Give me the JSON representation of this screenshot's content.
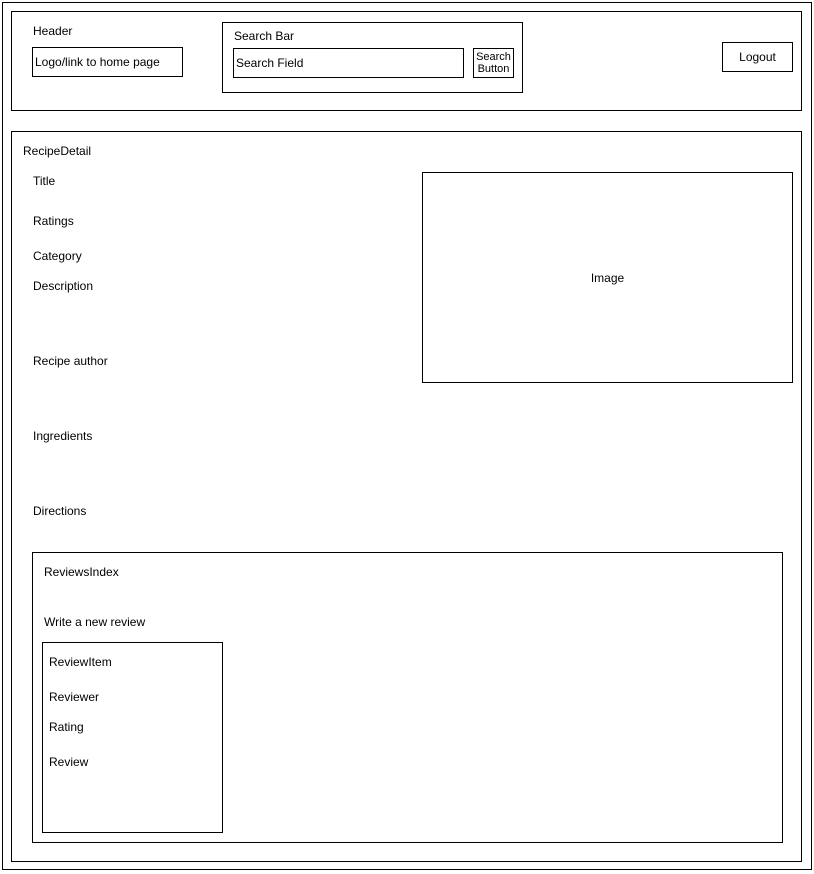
{
  "page": {
    "outer_frame": ""
  },
  "header": {
    "label": "Header",
    "logo": "Logo/link to home page",
    "search_bar": {
      "label": "Search Bar",
      "field": "Search Field",
      "button_line1": "Search",
      "button_line2": "Button"
    },
    "logout": "Logout"
  },
  "recipe_detail": {
    "label": "RecipeDetail",
    "fields": {
      "title": "Title",
      "ratings": "Ratings",
      "category": "Category",
      "description": "Description",
      "author": "Recipe author",
      "ingredients": "Ingredients",
      "directions": "Directions"
    },
    "image": "Image",
    "reviews_index": {
      "label": "ReviewsIndex",
      "write_review": "Write a new review",
      "review_item": {
        "label": "ReviewItem",
        "reviewer": "Reviewer",
        "rating": "Rating",
        "review": "Review"
      }
    }
  }
}
